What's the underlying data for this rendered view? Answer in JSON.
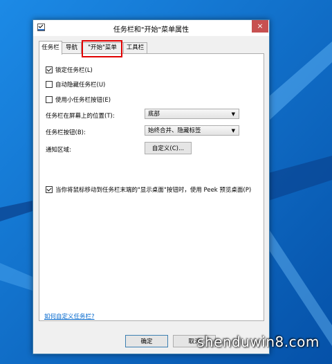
{
  "window": {
    "title": "任务栏和\"开始\"菜单属性",
    "close": "×"
  },
  "tabs": [
    {
      "label": "任务栏",
      "active": true
    },
    {
      "label": "导航",
      "active": false
    },
    {
      "label": "\"开始\"菜单",
      "active": false
    },
    {
      "label": "工具栏",
      "active": false
    }
  ],
  "options": {
    "lock_taskbar": {
      "label": "锁定任务栏(L)",
      "checked": true
    },
    "auto_hide": {
      "label": "自动隐藏任务栏(U)",
      "checked": false
    },
    "small_buttons": {
      "label": "使用小任务栏按钮(E)",
      "checked": false
    },
    "position_label": "任务栏在屏幕上的位置(T):",
    "position_value": "底部",
    "buttons_label": "任务栏按钮(B):",
    "buttons_value": "始终合并、隐藏标签",
    "notify_label": "通知区域:",
    "customize_button": "自定义(C)...",
    "peek": {
      "label": "当你将鼠标移动到任务栏末端的\"显示桌面\"按钮时，使用 Peek 预览桌面(P)",
      "checked": true
    }
  },
  "help_link": "如何自定义任务栏?",
  "footer": {
    "ok": "确定",
    "cancel": "取消"
  },
  "watermark": "shenduwin8.com",
  "colors": {
    "desktop": "#0a67c9",
    "close": "#c75050",
    "highlight": "#e00000",
    "link": "#0066cc"
  }
}
